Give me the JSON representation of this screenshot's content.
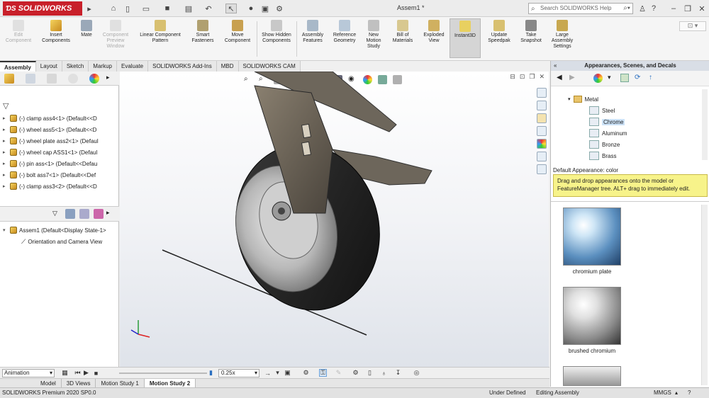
{
  "app": {
    "brand": "SOLIDWORKS",
    "document_title": "Assem1 *",
    "help_search_placeholder": "Search SOLIDWORKS Help"
  },
  "toolbar_icons": [
    "home-icon",
    "new-icon",
    "open-icon",
    "save-icon",
    "print-icon",
    "undo-icon",
    "select-icon",
    "rebuild-icon",
    "options-icon"
  ],
  "commands": [
    {
      "label": "Edit Component",
      "disabled": true
    },
    {
      "label": "Insert Components"
    },
    {
      "label": "Mate"
    },
    {
      "label": "Component Preview Window",
      "disabled": true
    },
    {
      "label": "Linear Component Pattern"
    },
    {
      "label": "Smart Fasteners"
    },
    {
      "label": "Move Component"
    },
    {
      "label": "Show Hidden Components"
    },
    {
      "label": "Assembly Features"
    },
    {
      "label": "Reference Geometry"
    },
    {
      "label": "New Motion Study"
    },
    {
      "label": "Bill of Materials"
    },
    {
      "label": "Exploded View"
    },
    {
      "label": "Instant3D",
      "active": true
    },
    {
      "label": "Update Speedpak"
    },
    {
      "label": "Take Snapshot"
    },
    {
      "label": "Large Assembly Settings"
    }
  ],
  "tabs": [
    "Assembly",
    "Layout",
    "Sketch",
    "Markup",
    "Evaluate",
    "SOLIDWORKS Add-Ins",
    "MBD",
    "SOLIDWORKS CAM"
  ],
  "feature_tree": [
    "(-) clamp ass4<1> (Default<<D",
    "(-) wheel ass5<1> (Default<<D",
    "(-) wheel plate ass2<1> (Defaul",
    "(-) wheel cap ASS1<1> (Defaul",
    "(-) pin ass<1> (Default<<Defau",
    "(-) bolt ass7<1> (Default<<Def",
    "(-) clamp ass3<2> (Default<<D"
  ],
  "lower_tree": {
    "root": "Assem1 (Default<Display State-1>",
    "child": "Orientation and Camera View"
  },
  "appearances": {
    "title": "Appearances, Scenes, and Decals",
    "folder": "Metal",
    "materials": [
      "Steel",
      "Chrome",
      "Aluminum",
      "Bronze",
      "Brass"
    ],
    "selected": "Chrome",
    "default_appearance": "Default Appearance: color",
    "tooltip": "Drag and drop appearances onto the model or FeatureManager tree.  ALT+ drag to immediately edit.",
    "swatches": [
      "chromium plate",
      "brushed chromium"
    ]
  },
  "motion": {
    "mode": "Animation",
    "speed": "0.25x",
    "study_tabs": [
      "Model",
      "3D Views",
      "Motion Study 1",
      "Motion Study 2"
    ],
    "selected_study": "Motion Study 2"
  },
  "status": {
    "version": "SOLIDWORKS Premium 2020 SP0.0",
    "state": "Under Defined",
    "mode": "Editing Assembly",
    "units": "MMGS"
  }
}
